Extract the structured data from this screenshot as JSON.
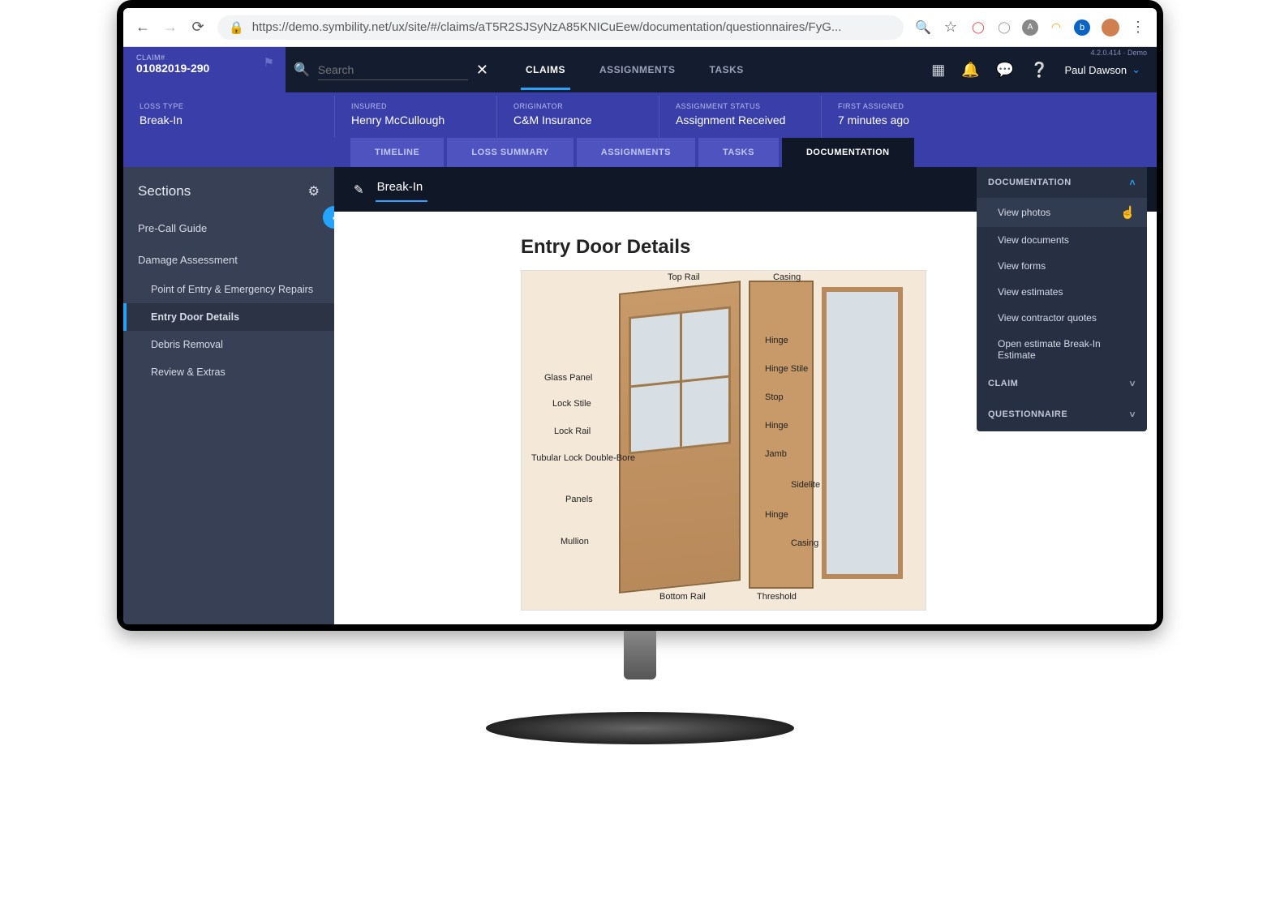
{
  "browser": {
    "url": "https://demo.symbility.net/ux/site/#/claims/aT5R2SJSyNzA85KNICuEew/documentation/questionnaires/FyG..."
  },
  "version": "4.2.0.414 · Demo",
  "claim": {
    "label": "CLAIM#",
    "number": "01082019-290"
  },
  "search_placeholder": "Search",
  "main_tabs": {
    "claims": "CLAIMS",
    "assignments": "ASSIGNMENTS",
    "tasks": "TASKS"
  },
  "user_name": "Paul Dawson",
  "summary": {
    "loss_type_l": "LOSS TYPE",
    "loss_type": "Break-In",
    "insured_l": "INSURED",
    "insured": "Henry McCullough",
    "originator_l": "ORIGINATOR",
    "originator": "C&M Insurance",
    "status_l": "ASSIGNMENT STATUS",
    "status": "Assignment Received",
    "first_l": "FIRST ASSIGNED",
    "first": "7 minutes ago"
  },
  "subtabs": {
    "timeline": "TIMELINE",
    "loss": "LOSS SUMMARY",
    "assign": "ASSIGNMENTS",
    "tasks": "TASKS",
    "doc": "DOCUMENTATION"
  },
  "sidebar": {
    "title": "Sections",
    "precall": "Pre-Call Guide",
    "damage": "Damage Assessment",
    "poe": "Point of Entry & Emergency Repairs",
    "entry": "Entry Door Details",
    "debris": "Debris Removal",
    "review": "Review & Extras"
  },
  "content": {
    "header": "Break-In",
    "page_title": "Entry Door Details"
  },
  "diagram": {
    "top_rail": "Top Rail",
    "casing": "Casing",
    "hinge": "Hinge",
    "hinge_stile": "Hinge Stile",
    "glass_panel": "Glass Panel",
    "lock_stile": "Lock Stile",
    "lock_rail": "Lock Rail",
    "tubular": "Tubular Lock Double-Bore",
    "panels": "Panels",
    "mullion": "Mullion",
    "bottom_rail": "Bottom Rail",
    "stop": "Stop",
    "jamb": "Jamb",
    "sidelite": "Sidelite",
    "threshold": "Threshold",
    "casing2": "Casing"
  },
  "flyout": {
    "hdr1": "DOCUMENTATION",
    "photos": "View photos",
    "docs": "View documents",
    "forms": "View forms",
    "est": "View estimates",
    "quotes": "View contractor quotes",
    "open": "Open estimate Break-In Estimate",
    "hdr2": "CLAIM",
    "hdr3": "QUESTIONNAIRE"
  }
}
